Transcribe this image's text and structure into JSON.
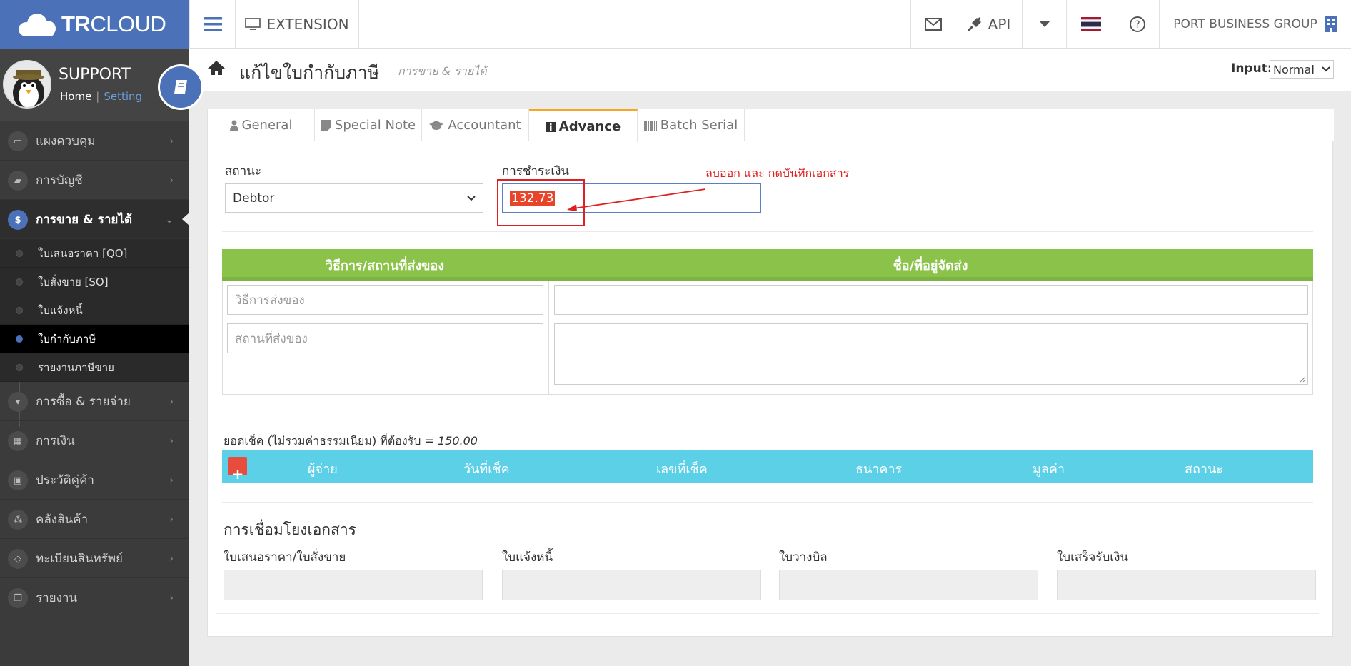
{
  "brand": {
    "logo_text_bold": "TR",
    "logo_text_thin": "CLOUD"
  },
  "topbar": {
    "extension_label": "EXTENSION",
    "api_label": "API",
    "company": "PORT BUSINESS GROUP"
  },
  "profile": {
    "name": "SUPPORT",
    "home": "Home",
    "separator": "|",
    "setting": "Setting"
  },
  "sidebar": {
    "items": [
      {
        "label": "แผงควบคุม",
        "icon": "monitor-icon"
      },
      {
        "label": "การบัญชี",
        "icon": "book-icon"
      },
      {
        "label": "การขาย & รายได้",
        "icon": "dollar-icon"
      },
      {
        "label": "การซื้อ & รายจ่าย",
        "icon": "cart-icon"
      },
      {
        "label": "การเงิน",
        "icon": "calendar-icon"
      },
      {
        "label": "ประวัติคู่ค้า",
        "icon": "contact-icon"
      },
      {
        "label": "คลังสินค้า",
        "icon": "cubes-icon"
      },
      {
        "label": "ทะเบียนสินทรัพย์",
        "icon": "diamond-icon"
      },
      {
        "label": "รายงาน",
        "icon": "report-icon"
      }
    ],
    "sub_items": [
      {
        "label": "ใบเสนอราคา [QO]"
      },
      {
        "label": "ใบสั่งขาย [SO]"
      },
      {
        "label": "ใบแจ้งหนี้"
      },
      {
        "label": "ใบกำกับภาษี"
      },
      {
        "label": "รายงานภาษีขาย"
      }
    ]
  },
  "page": {
    "title": "แก้ไขใบกำกับภาษี",
    "subtitle": "การขาย & รายได้",
    "input_label": "Input:",
    "input_value": "Normal"
  },
  "tabs": [
    "General",
    "Special Note",
    "Accountant",
    "Advance",
    "Batch Serial"
  ],
  "form": {
    "status_label": "สถานะ",
    "status_value": "Debtor",
    "payment_label": "การชำระเงิน",
    "payment_value": "132.73",
    "annotation": "ลบออก และ กดบันทึกเอกสาร"
  },
  "shipping": {
    "col1_header": "วิธีการ/สถานที่ส่งของ",
    "col2_header": "ชื่อ/ที่อยู่จัดส่ง",
    "method_placeholder": "วิธีการส่งของ",
    "place_placeholder": "สถานที่ส่งของ"
  },
  "cheque": {
    "summary_label": "ยอดเช็ค (ไม่รวมค่าธรรมเนียม) ที่ต้องรับ =",
    "summary_value": "150.00",
    "columns": [
      "ผู้จ่าย",
      "วันที่เช็ค",
      "เลขที่เช็ค",
      "ธนาคาร",
      "มูลค่า",
      "สถานะ"
    ]
  },
  "links": {
    "title": "การเชื่อมโยงเอกสาร",
    "labels": [
      "ใบเสนอราคา/ใบสั่งขาย",
      "ใบแจ้งหนี้",
      "ใบวางบิล",
      "ใบเสร็จรับเงิน"
    ]
  },
  "colors": {
    "brand": "#4b72b8",
    "green": "#8bc34a",
    "cyan": "#5bd0e6",
    "annotation": "#e02020"
  }
}
